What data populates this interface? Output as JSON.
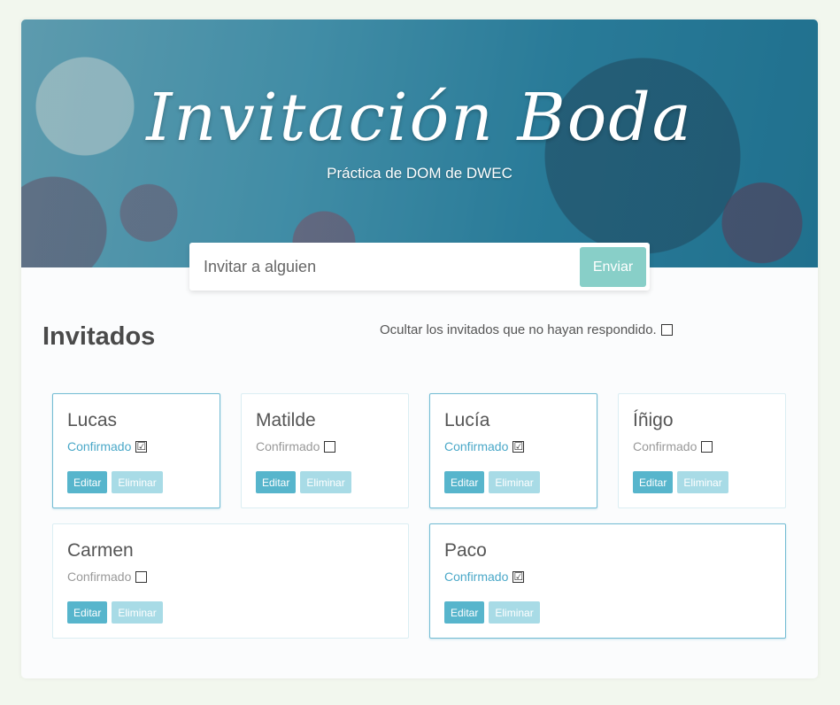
{
  "header": {
    "title": "Invitación Boda",
    "subtitle": "Práctica de DOM de DWEC"
  },
  "invite": {
    "placeholder": "Invitar a alguien",
    "button": "Enviar"
  },
  "section": {
    "title": "Invitados",
    "filter_label": "Ocultar los invitados que no hayan respondido."
  },
  "guests": [
    {
      "name": "Lucas",
      "status": "Confirmado",
      "check": "☑"
    },
    {
      "name": "Matilde",
      "status": "Confirmado",
      "check": ""
    },
    {
      "name": "Lucía",
      "status": "Confirmado",
      "check": "☑"
    },
    {
      "name": "Íñigo",
      "status": "Confirmado",
      "check": ""
    },
    {
      "name": "Carmen",
      "status": "Confirmado",
      "check": ""
    },
    {
      "name": "Paco",
      "status": "Confirmado",
      "check": "☑"
    }
  ],
  "actions": {
    "edit": "Editar",
    "delete": "Eliminar"
  },
  "colors": {
    "accent": "#57b5cc",
    "send_button": "#88cfc8",
    "confirmed_text": "#4aa8c8"
  }
}
